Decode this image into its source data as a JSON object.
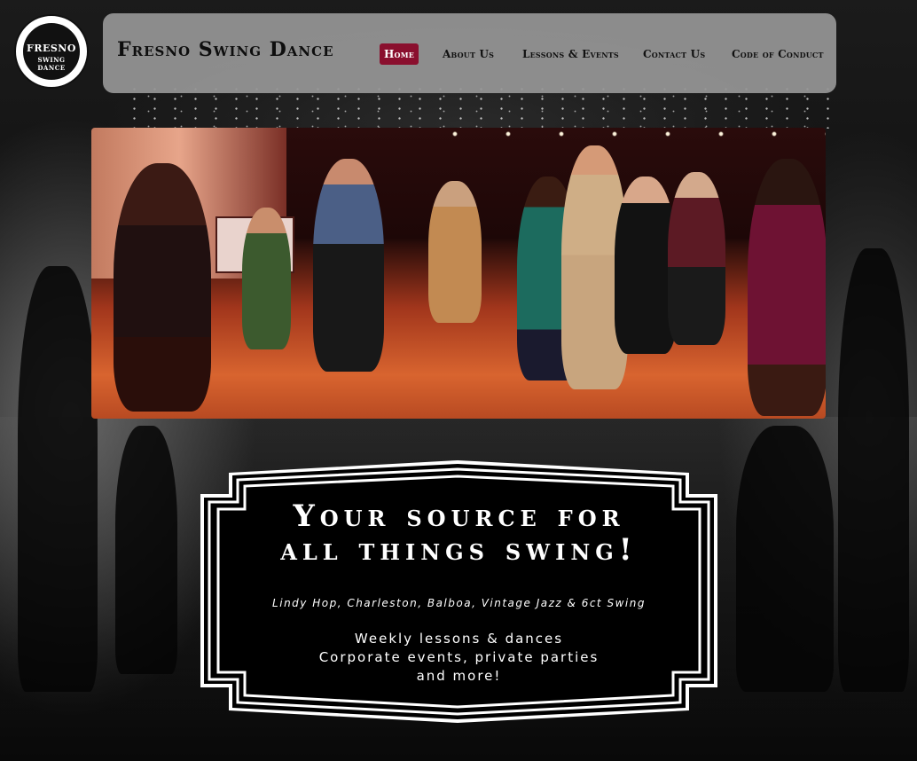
{
  "site": {
    "logo_line1": "FRESNO",
    "logo_line2": "SWING DANCE",
    "title": "Fresno Swing Dance"
  },
  "nav": {
    "items": [
      {
        "label": "Home",
        "active": true
      },
      {
        "label": "About Us",
        "active": false
      },
      {
        "label": "Lessons & Events",
        "active": false
      },
      {
        "label": "Contact Us",
        "active": false
      },
      {
        "label": "Code of Conduct",
        "active": false
      }
    ]
  },
  "banner": {
    "title_line1": "Your source for",
    "title_line2": "all things swing!",
    "styles": "Lindy Hop, Charleston, Balboa, Vintage Jazz & 6ct Swing",
    "line1": "Weekly lessons & dances",
    "line2": "Corporate events, private parties",
    "line3": "and more!"
  },
  "colors": {
    "accent": "#8a0f2e",
    "header_bg": "#969696",
    "banner_bg": "#000000"
  }
}
